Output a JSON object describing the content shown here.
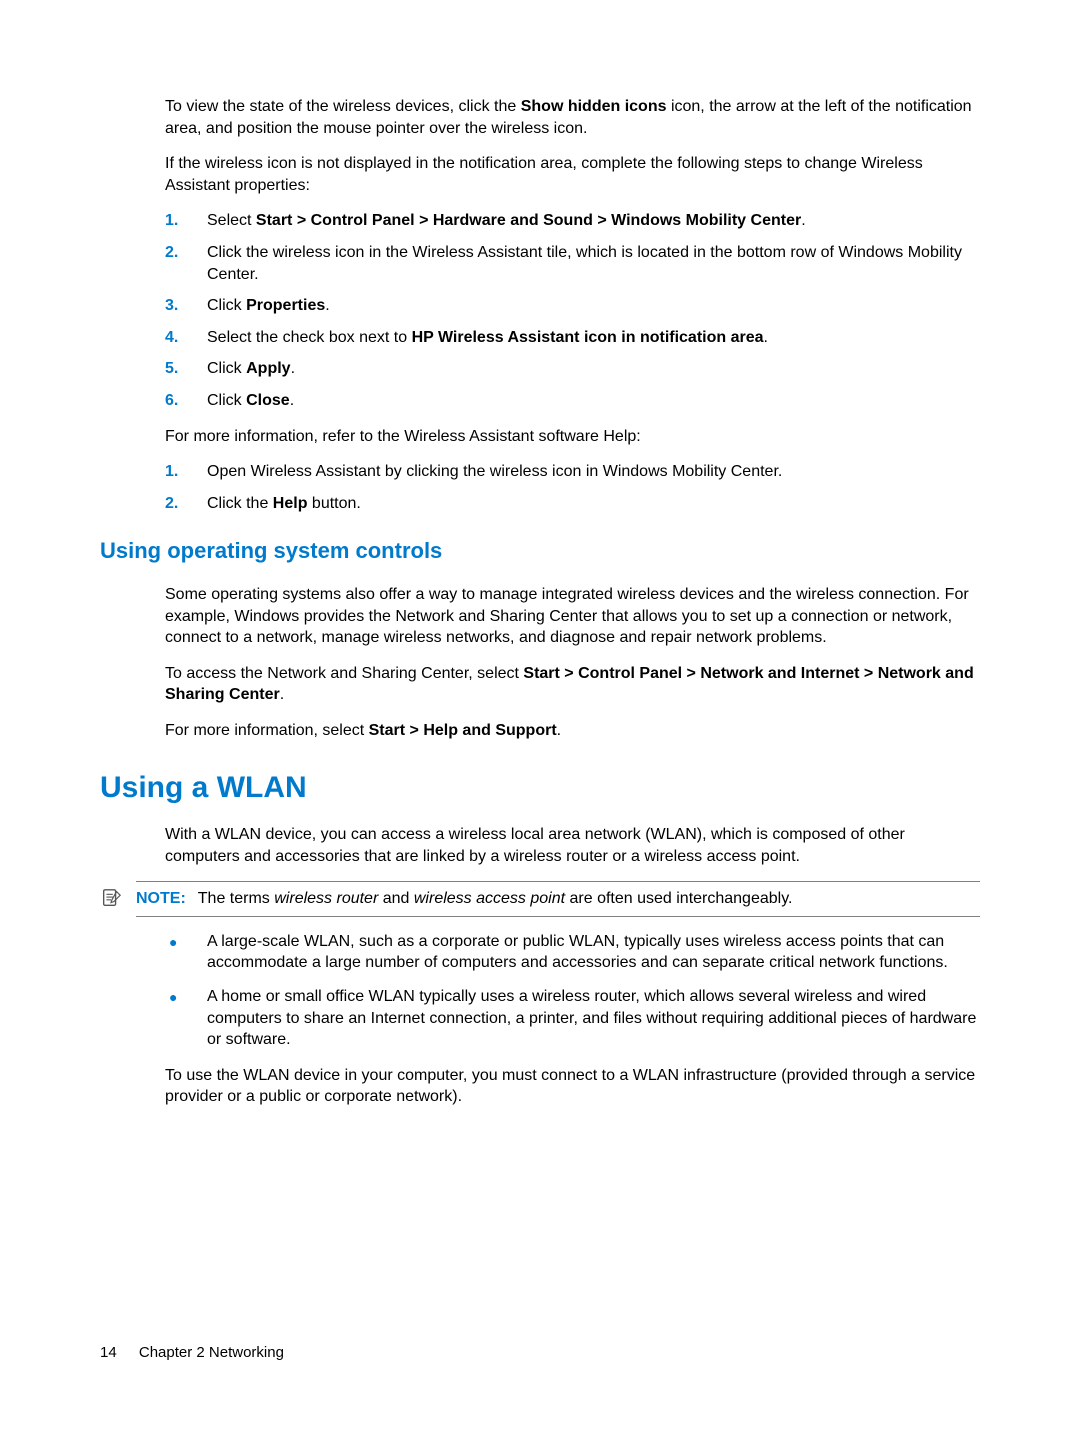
{
  "intro": {
    "p1_a": "To view the state of the wireless devices, click the ",
    "p1_b": "Show hidden icons",
    "p1_c": " icon, the arrow at the left of the notification area, and position the mouse pointer over the wireless icon.",
    "p2": "If the wireless icon is not displayed in the notification area, complete the following steps to change Wireless Assistant properties:"
  },
  "list1": {
    "n1": "1.",
    "n2": "2.",
    "n3": "3.",
    "n4": "4.",
    "n5": "5.",
    "n6": "6.",
    "i1_a": "Select ",
    "i1_b": "Start > Control Panel > Hardware and Sound > Windows Mobility Center",
    "i1_c": ".",
    "i2": "Click the wireless icon in the Wireless Assistant tile, which is located in the bottom row of Windows Mobility Center.",
    "i3_a": "Click ",
    "i3_b": "Properties",
    "i3_c": ".",
    "i4_a": "Select the check box next to ",
    "i4_b": "HP Wireless Assistant icon in notification area",
    "i4_c": ".",
    "i5_a": "Click ",
    "i5_b": "Apply",
    "i5_c": ".",
    "i6_a": "Click ",
    "i6_b": "Close",
    "i6_c": "."
  },
  "mid": {
    "p1": "For more information, refer to the Wireless Assistant software Help:"
  },
  "list2": {
    "n1": "1.",
    "n2": "2.",
    "i1": "Open Wireless Assistant by clicking the wireless icon in Windows Mobility Center.",
    "i2_a": "Click the ",
    "i2_b": "Help",
    "i2_c": " button."
  },
  "sub1": {
    "title": "Using operating system controls",
    "p1": "Some operating systems also offer a way to manage integrated wireless devices and the wireless connection. For example, Windows provides the Network and Sharing Center that allows you to set up a connection or network, connect to a network, manage wireless networks, and diagnose and repair network problems.",
    "p2_a": "To access the Network and Sharing Center, select ",
    "p2_b": "Start > Control Panel > Network and Internet > Network and Sharing Center",
    "p2_c": ".",
    "p3_a": "For more information, select ",
    "p3_b": "Start > Help and Support",
    "p3_c": "."
  },
  "sec": {
    "title": "Using a WLAN",
    "p1": "With a WLAN device, you can access a wireless local area network (WLAN), which is composed of other computers and accessories that are linked by a wireless router or a wireless access point."
  },
  "note": {
    "label": "NOTE:",
    "a": "The terms ",
    "b": "wireless router",
    "c": " and ",
    "d": "wireless access point",
    "e": " are often used interchangeably."
  },
  "bullets": {
    "dot": "●",
    "i1": "A large-scale WLAN, such as a corporate or public WLAN, typically uses wireless access points that can accommodate a large number of computers and accessories and can separate critical network functions.",
    "i2": "A home or small office WLAN typically uses a wireless router, which allows several wireless and wired computers to share an Internet connection, a printer, and files without requiring additional pieces of hardware or software."
  },
  "closing": {
    "p1": "To use the WLAN device in your computer, you must connect to a WLAN infrastructure (provided through a service provider or a public or corporate network)."
  },
  "footer": {
    "page": "14",
    "chapter": "Chapter 2   Networking"
  }
}
